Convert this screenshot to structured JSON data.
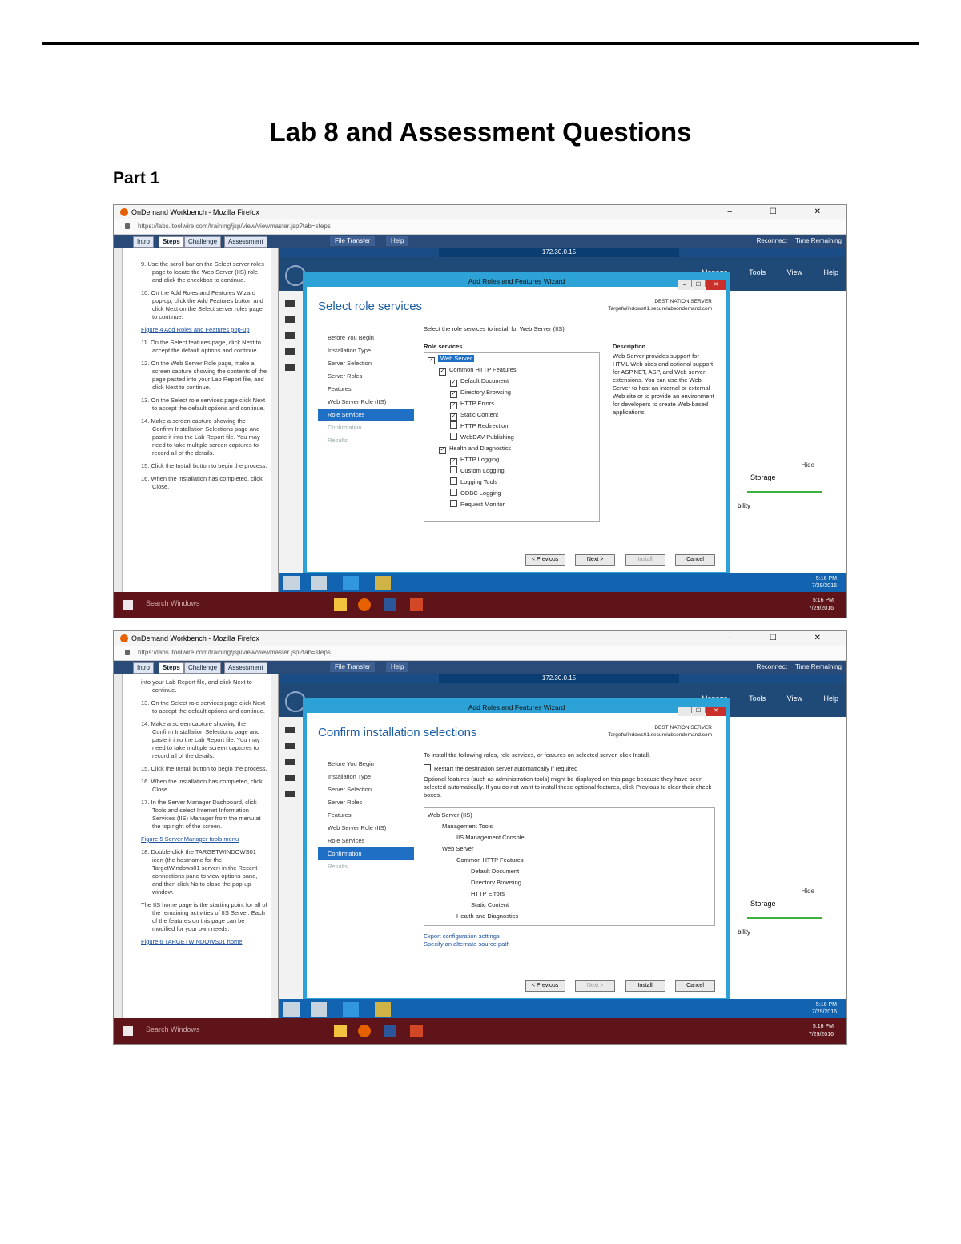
{
  "document": {
    "title": "Lab 8 and Assessment Questions",
    "part": "Part 1"
  },
  "browser": {
    "title": "OnDemand Workbench - Mozilla Firefox",
    "url": "https://labs.itoolwire.com/training/jsp/view/viewmaster.jsp?tab=steps",
    "window_controls": "–  ☐  ✕"
  },
  "toolbar": {
    "tabs": [
      "Intro",
      "Steps",
      "Challenge",
      "Assessment"
    ],
    "file_transfer": "File Transfer",
    "help": "Help",
    "reconnect": "Reconnect",
    "time_remaining": "Time Remaining",
    "remote_address": "172.30.0.15"
  },
  "server_manager": {
    "menu": [
      "Manage",
      "Tools",
      "View",
      "Help"
    ],
    "hide": "Hide",
    "storage": "Storage",
    "bility": "bility"
  },
  "shot1": {
    "steps": [
      {
        "text": "9. Use the scroll bar on the Select server roles page to locate the Web Server (IIS) role and click the checkbox to continue."
      },
      {
        "text": "10. On the Add Roles and Features Wizard pop-up, click the Add Features button and click Next on the Select server roles page to continue."
      },
      {
        "text": "Figure 4 Add Roles and Features pop-up",
        "link": true
      },
      {
        "text": "11. On the Select features page, click Next to accept the default options and continue."
      },
      {
        "text": "12. On the Web Server Role page, make a screen capture showing the contents of the page pasted into your Lab Report file, and click Next to continue."
      },
      {
        "text": "13. On the Select role services page click Next to accept the default options and continue."
      },
      {
        "text": "14. Make a screen capture showing the Confirm Installation Selections page and paste it into the Lab Report file. You may need to take multiple screen captures to record all of the details."
      },
      {
        "text": "15. Click the Install button to begin the process."
      },
      {
        "text": "16. When the installation has completed, click Close."
      }
    ],
    "wizard": {
      "title": "Add Roles and Features Wizard",
      "heading": "Select role services",
      "dest_label": "DESTINATION SERVER",
      "dest_server": "TargetWindows01.securelabsondemand.com",
      "nav": [
        "Before You Begin",
        "Installation Type",
        "Server Selection",
        "Server Roles",
        "Features",
        "Web Server Role (IIS)",
        "Role Services",
        "Confirmation",
        "Results"
      ],
      "nav_current": "Role Services",
      "instruction": "Select the role services to install for Web Server (IIS)",
      "role_services_label": "Role services",
      "description_label": "Description",
      "description": "Web Server provides support for HTML Web sites and optional support for ASP.NET, ASP, and Web server extensions. You can use the Web Server to host an internal or external Web site or to provide an environment for developers to create Web-based applications.",
      "tree": [
        {
          "label": "Web Server",
          "indent": 0,
          "checked": true,
          "selected": true
        },
        {
          "label": "Common HTTP Features",
          "indent": 1,
          "checked": true
        },
        {
          "label": "Default Document",
          "indent": 2,
          "checked": true
        },
        {
          "label": "Directory Browsing",
          "indent": 2,
          "checked": true
        },
        {
          "label": "HTTP Errors",
          "indent": 2,
          "checked": true
        },
        {
          "label": "Static Content",
          "indent": 2,
          "checked": true
        },
        {
          "label": "HTTP Redirection",
          "indent": 2,
          "checked": false
        },
        {
          "label": "WebDAV Publishing",
          "indent": 2,
          "checked": false
        },
        {
          "label": "Health and Diagnostics",
          "indent": 1,
          "checked": true
        },
        {
          "label": "HTTP Logging",
          "indent": 2,
          "checked": true
        },
        {
          "label": "Custom Logging",
          "indent": 2,
          "checked": false
        },
        {
          "label": "Logging Tools",
          "indent": 2,
          "checked": false
        },
        {
          "label": "ODBC Logging",
          "indent": 2,
          "checked": false
        },
        {
          "label": "Request Monitor",
          "indent": 2,
          "checked": false
        }
      ],
      "buttons": {
        "previous": "< Previous",
        "next": "Next >",
        "install": "Install",
        "cancel": "Cancel"
      }
    }
  },
  "shot2": {
    "steps": [
      {
        "text": "into your Lab Report file, and click Next to continue."
      },
      {
        "text": "13. On the Select role services page click Next to accept the default options and continue."
      },
      {
        "text": "14. Make a screen capture showing the Confirm Installation Selections page and paste it into the Lab Report file. You may need to take multiple screen captures to record all of the details."
      },
      {
        "text": "15. Click the Install button to begin the process."
      },
      {
        "text": "16. When the installation has completed, click Close."
      },
      {
        "text": "17. In the Server Manager Dashboard, click Tools and select Internet Information Services (IIS) Manager from the menu at the top right of the screen."
      },
      {
        "text": "Figure 5 Server Manager tools menu",
        "link": true
      },
      {
        "text": "18. Double-click the TARGETWINDOWS01 icon (the hostname for the TargetWindows01 server) in the Recent connections pane to view options pane, and then click No to close the pop-up window."
      },
      {
        "text": "The IIS home page is the starting point for all of the remaining activities of IIS Server. Each of the features on this page can be modified for your own needs."
      },
      {
        "text": "Figure 6 TARGETWINDOWS01 home",
        "link": true
      }
    ],
    "wizard": {
      "title": "Add Roles and Features Wizard",
      "heading": "Confirm installation selections",
      "dest_label": "DESTINATION SERVER",
      "dest_server": "TargetWindows01.securelabsondemand.com",
      "nav": [
        "Before You Begin",
        "Installation Type",
        "Server Selection",
        "Server Roles",
        "Features",
        "Web Server Role (IIS)",
        "Role Services",
        "Confirmation",
        "Results"
      ],
      "nav_current": "Confirmation",
      "instruction": "To install the following roles, role services, or features on selected server, click Install.",
      "restart_option": "Restart the destination server automatically if required",
      "optional_note": "Optional features (such as administration tools) might be displayed on this page because they have been selected automatically. If you do not want to install these optional features, click Previous to clear their check boxes.",
      "items": [
        {
          "label": "Web Server (IIS)",
          "indent": 0
        },
        {
          "label": "Management Tools",
          "indent": 1
        },
        {
          "label": "IIS Management Console",
          "indent": 2
        },
        {
          "label": "Web Server",
          "indent": 1
        },
        {
          "label": "Common HTTP Features",
          "indent": 2
        },
        {
          "label": "Default Document",
          "indent": 3
        },
        {
          "label": "Directory Browsing",
          "indent": 3
        },
        {
          "label": "HTTP Errors",
          "indent": 3
        },
        {
          "label": "Static Content",
          "indent": 3
        },
        {
          "label": "Health and Diagnostics",
          "indent": 2
        }
      ],
      "export_link": "Export configuration settings",
      "source_link": "Specify an alternate source path",
      "buttons": {
        "previous": "< Previous",
        "next": "Next >",
        "install": "Install",
        "cancel": "Cancel"
      }
    }
  },
  "remote_tray": {
    "time": "5:16 PM",
    "date": "7/29/2016"
  },
  "host_taskbar": {
    "search": "Search Windows",
    "time": "5:16 PM",
    "date": "7/29/2016"
  },
  "colors": {
    "wizard_border": "#2ca2d6",
    "host_taskbar": "#5e1418",
    "remote_taskbar": "#1263b0",
    "nav_selected": "#1f6fc4"
  }
}
